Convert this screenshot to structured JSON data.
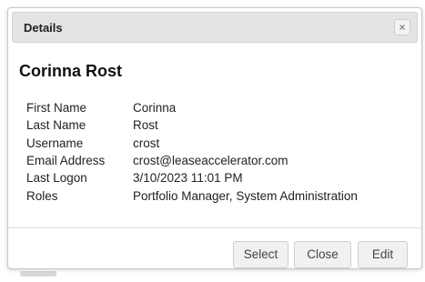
{
  "dialog": {
    "title": "Details",
    "close_icon": "close-icon",
    "close_glyph": "×"
  },
  "person": {
    "name": "Corinna Rost"
  },
  "fields": [
    {
      "label": "First Name",
      "value": "Corinna"
    },
    {
      "label": "Last Name",
      "value": "Rost"
    },
    {
      "label": "Username",
      "value": "crost"
    },
    {
      "label": "Email Address",
      "value": "crost@leaseaccelerator.com"
    },
    {
      "label": "Last Logon",
      "value": "3/10/2023 11:01 PM"
    },
    {
      "label": "Roles",
      "value": "Portfolio Manager, System Administration"
    }
  ],
  "buttons": {
    "select_label": "Select",
    "close_label": "Close",
    "edit_label": "Edit"
  },
  "colors": {
    "titlebar_bg": "#e4e4e4",
    "button_bg": "#f1f1f1",
    "text": "#222222"
  }
}
